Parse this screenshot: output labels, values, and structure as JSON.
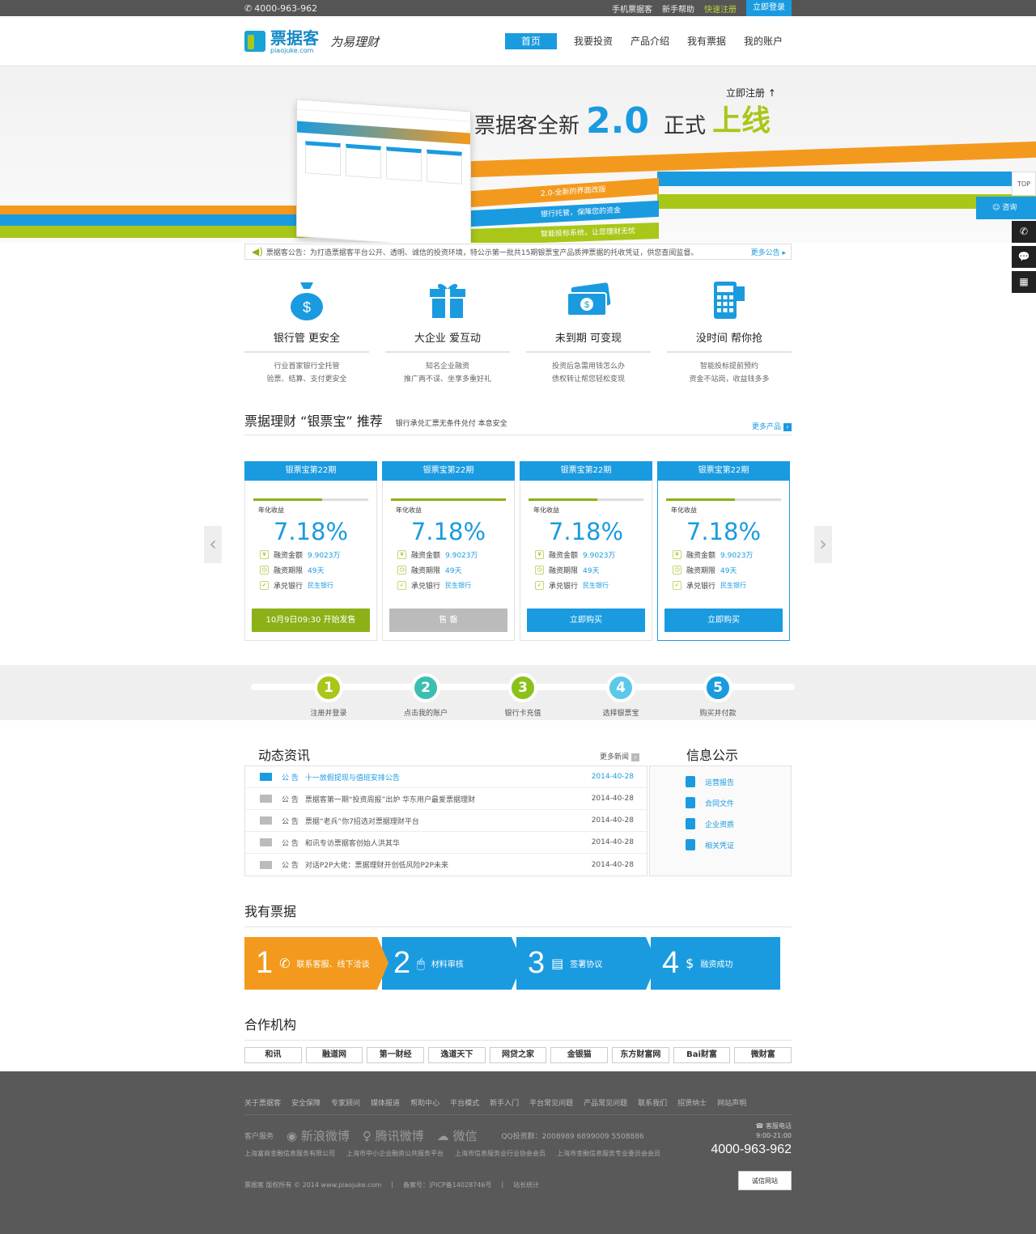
{
  "topbar": {
    "phone": "4000-963-962",
    "mobile": "手机票据客",
    "help": "新手帮助",
    "register": "快速注册",
    "login": "立即登录"
  },
  "header": {
    "logo_cn": "票据客",
    "logo_en": "piaojuke.com",
    "slogan": "为易理财",
    "nav": [
      "首页",
      "我要投资",
      "产品介绍",
      "我有票据",
      "我的账户"
    ]
  },
  "banner": {
    "register_now": "立即注册 ↑",
    "headline_1": "票据客全新",
    "headline_version": "2.0",
    "headline_2": "正式",
    "headline_3": "上线",
    "ribbons": [
      "2.0-全新的界面改版",
      "银行托管，保障您的资金",
      "智能投标系统，让您理财无忧"
    ]
  },
  "notice": {
    "text": "票据客公告：为打造票据客平台公开、透明、诚信的投资环境，特公示第一批共15期银票宝产品质押票据的托收凭证，供您查阅监督。",
    "more": "更多公告"
  },
  "features": [
    {
      "icon": "money-bag-icon",
      "title": "银行管 更安全",
      "desc": [
        "行业首家银行全托管",
        "验票、结算、支付更安全"
      ]
    },
    {
      "icon": "gift-icon",
      "title": "大企业 爱互动",
      "desc": [
        "知名企业融资",
        "推广两不误、坐享多重好礼"
      ]
    },
    {
      "icon": "cash-icon",
      "title": "未到期  可变现",
      "desc": [
        "投资后急需用钱怎么办",
        "债权转让帮您轻松变现"
      ]
    },
    {
      "icon": "phone-icon",
      "title": "没时间  帮你抢",
      "desc": [
        "智能投标提前预约",
        "资金不站岗，收益钱多多"
      ]
    }
  ],
  "products": {
    "title": "票据理财 “银票宝” 推荐",
    "subtitle": "银行承兑汇票无条件兑付  本息安全",
    "more": "更多产品",
    "rate_label": "年化收益",
    "amount_label": "融资金额",
    "term_label": "融资期限",
    "bank_label": "承兑银行",
    "cards": [
      {
        "name": "银票宝第22期",
        "progress": 0.6,
        "rate": "7.18%",
        "amount": "9.9023万",
        "term": "49天",
        "bank": "民生银行",
        "button": "10月9日09:30  开始发售",
        "state": "green"
      },
      {
        "name": "银票宝第22期",
        "progress": 1.0,
        "rate": "7.18%",
        "amount": "9.9023万",
        "term": "49天",
        "bank": "民生银行",
        "button": "售  罄",
        "state": "gray"
      },
      {
        "name": "银票宝第22期",
        "progress": 0.6,
        "rate": "7.18%",
        "amount": "9.9023万",
        "term": "49天",
        "bank": "民生银行",
        "button": "立即购买",
        "state": "blue"
      },
      {
        "name": "银票宝第22期",
        "progress": 0.6,
        "rate": "7.18%",
        "amount": "9.9023万",
        "term": "49天",
        "bank": "民生银行",
        "button": "立即购买",
        "state": "blue"
      }
    ]
  },
  "steps": [
    {
      "num": "1",
      "label": "注册并登录",
      "color": "#a8c718"
    },
    {
      "num": "2",
      "label": "点击我的账户",
      "color": "#3cbfb1"
    },
    {
      "num": "3",
      "label": "银行卡充值",
      "color": "#8bc21a"
    },
    {
      "num": "4",
      "label": "选择银票宝",
      "color": "#5cc8ea"
    },
    {
      "num": "5",
      "label": "购买并付款",
      "color": "#1a9be0"
    }
  ],
  "news": {
    "title": "动态资讯",
    "more": "更多新闻",
    "tag": "公 告",
    "items": [
      {
        "text": "十一放假提现与值班安排公告",
        "date": "2014-40-28"
      },
      {
        "text": "票据客第一期“投资周报”出炉 华东用户最爱票据理财",
        "date": "2014-40-28"
      },
      {
        "text": "票据“老兵”你7招选对票据理财平台",
        "date": "2014-40-28"
      },
      {
        "text": "和讯专访票据客创始人洪其华",
        "date": "2014-40-28"
      },
      {
        "text": "对话P2P大佬：票据理财开创低风险P2P未来",
        "date": "2014-40-28"
      }
    ]
  },
  "info": {
    "title": "信息公示",
    "items": [
      "运营报告",
      "合同文件",
      "企业资质",
      "相关凭证"
    ]
  },
  "bills": {
    "title": "我有票据",
    "steps": [
      {
        "num": "1",
        "icon": "✆",
        "text": "联系客服、线下洽谈"
      },
      {
        "num": "2",
        "icon": "🖱",
        "text": "材料审核"
      },
      {
        "num": "3",
        "icon": "▤",
        "text": "签署协议"
      },
      {
        "num": "4",
        "icon": "$",
        "text": "融资成功"
      }
    ]
  },
  "partners": {
    "title": "合作机构",
    "items": [
      "和讯",
      "融道网",
      "第一财经",
      "逸道天下",
      "网贷之家",
      "金银猫",
      "东方财富网",
      "Bai财富",
      "微财富"
    ]
  },
  "footer": {
    "links": [
      "关于票据客",
      "安全保障",
      "专家顾问",
      "媒体报道",
      "帮助中心",
      "平台模式",
      "新手入门",
      "平台常见问题",
      "产品常见问题",
      "联系我们",
      "招贤纳士",
      "网站声明"
    ],
    "service_label": "客户服务",
    "weibo": "新浪微博",
    "tencent": "腾讯微博",
    "wechat": "微信",
    "qq": "QQ投资群：2008989  6899009  5508886",
    "service_phone_label": "客服电话",
    "service_hours": "9:00-21:00",
    "hotline": "4000-963-962",
    "orgs": [
      "上海富商金融信息服务有限公司",
      "上海市中小企业融资公共服务平台",
      "上海市信息服务业行业协会会员",
      "上海市金融信息服务专业委员会会员"
    ],
    "copyright": "票据客 版权所有  ©  2014  www.piaojuke.com",
    "icp": "备案号：沪ICP备14028746号",
    "stats": "站长统计",
    "badge": "诚信网站"
  },
  "side": {
    "top": "TOP",
    "consult": "咨询"
  }
}
